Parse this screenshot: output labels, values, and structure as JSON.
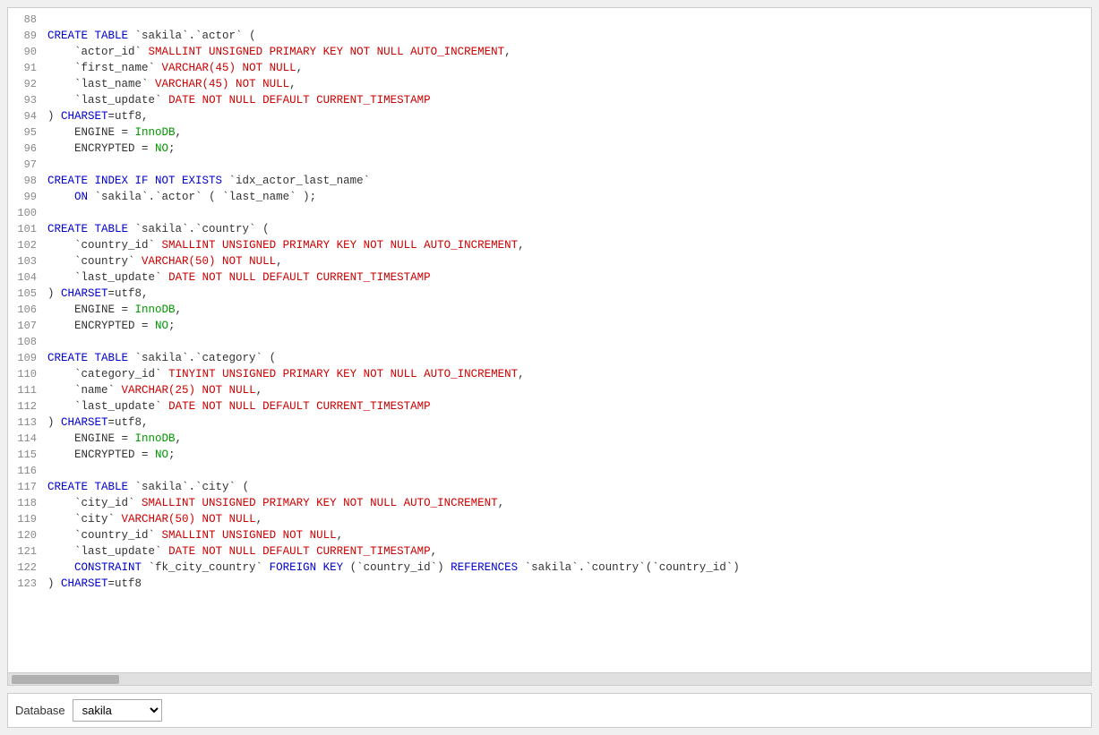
{
  "editor": {
    "lines": [
      {
        "num": "88",
        "tokens": []
      },
      {
        "num": "89",
        "tokens": [
          {
            "t": "kw",
            "v": "CREATE TABLE "
          },
          {
            "t": "str",
            "v": "`sakila`.`actor`"
          },
          {
            "t": "op",
            "v": " ("
          }
        ]
      },
      {
        "num": "90",
        "tokens": [
          {
            "t": "op",
            "v": "    "
          },
          {
            "t": "str",
            "v": "`actor_id`"
          },
          {
            "t": "op",
            "v": " "
          },
          {
            "t": "kw2",
            "v": "SMALLINT UNSIGNED PRIMARY KEY NOT NULL AUTO_INCREMENT"
          },
          {
            "t": "op",
            "v": ","
          }
        ]
      },
      {
        "num": "91",
        "tokens": [
          {
            "t": "op",
            "v": "    "
          },
          {
            "t": "str",
            "v": "`first_name`"
          },
          {
            "t": "op",
            "v": " "
          },
          {
            "t": "kw2",
            "v": "VARCHAR(45) NOT NULL"
          },
          {
            "t": "op",
            "v": ","
          }
        ]
      },
      {
        "num": "92",
        "tokens": [
          {
            "t": "op",
            "v": "    "
          },
          {
            "t": "str",
            "v": "`last_name`"
          },
          {
            "t": "op",
            "v": " "
          },
          {
            "t": "kw2",
            "v": "VARCHAR(45) NOT NULL"
          },
          {
            "t": "op",
            "v": ","
          }
        ]
      },
      {
        "num": "93",
        "tokens": [
          {
            "t": "op",
            "v": "    "
          },
          {
            "t": "str",
            "v": "`last_update`"
          },
          {
            "t": "op",
            "v": " "
          },
          {
            "t": "kw2",
            "v": "DATE NOT NULL DEFAULT CURRENT_TIMESTAMP"
          }
        ]
      },
      {
        "num": "94",
        "tokens": [
          {
            "t": "op",
            "v": ") "
          },
          {
            "t": "kw",
            "v": "CHARSET"
          },
          {
            "t": "op",
            "v": "=utf8,"
          }
        ]
      },
      {
        "num": "95",
        "tokens": [
          {
            "t": "op",
            "v": "    ENGINE = "
          },
          {
            "t": "val",
            "v": "InnoDB"
          },
          {
            "t": "op",
            "v": ","
          }
        ]
      },
      {
        "num": "96",
        "tokens": [
          {
            "t": "op",
            "v": "    ENCRYPTED = "
          },
          {
            "t": "val",
            "v": "NO"
          },
          {
            "t": "op",
            "v": ";"
          }
        ]
      },
      {
        "num": "97",
        "tokens": []
      },
      {
        "num": "98",
        "tokens": [
          {
            "t": "kw",
            "v": "CREATE INDEX IF NOT EXISTS "
          },
          {
            "t": "str",
            "v": "`idx_actor_last_name`"
          }
        ]
      },
      {
        "num": "99",
        "tokens": [
          {
            "t": "op",
            "v": "    "
          },
          {
            "t": "kw",
            "v": "ON "
          },
          {
            "t": "str",
            "v": "`sakila`.`actor`"
          },
          {
            "t": "op",
            "v": " ( "
          },
          {
            "t": "str",
            "v": "`last_name`"
          },
          {
            "t": "op",
            "v": " );"
          }
        ]
      },
      {
        "num": "100",
        "tokens": []
      },
      {
        "num": "101",
        "tokens": [
          {
            "t": "kw",
            "v": "CREATE TABLE "
          },
          {
            "t": "str",
            "v": "`sakila`.`country`"
          },
          {
            "t": "op",
            "v": " ("
          }
        ]
      },
      {
        "num": "102",
        "tokens": [
          {
            "t": "op",
            "v": "    "
          },
          {
            "t": "str",
            "v": "`country_id`"
          },
          {
            "t": "op",
            "v": " "
          },
          {
            "t": "kw2",
            "v": "SMALLINT UNSIGNED PRIMARY KEY NOT NULL AUTO_INCREMENT"
          },
          {
            "t": "op",
            "v": ","
          }
        ]
      },
      {
        "num": "103",
        "tokens": [
          {
            "t": "op",
            "v": "    "
          },
          {
            "t": "str",
            "v": "`country`"
          },
          {
            "t": "op",
            "v": " "
          },
          {
            "t": "kw2",
            "v": "VARCHAR(50) NOT NULL"
          },
          {
            "t": "op",
            "v": ","
          }
        ]
      },
      {
        "num": "104",
        "tokens": [
          {
            "t": "op",
            "v": "    "
          },
          {
            "t": "str",
            "v": "`last_update`"
          },
          {
            "t": "op",
            "v": " "
          },
          {
            "t": "kw2",
            "v": "DATE NOT NULL DEFAULT CURRENT_TIMESTAMP"
          }
        ]
      },
      {
        "num": "105",
        "tokens": [
          {
            "t": "op",
            "v": ") "
          },
          {
            "t": "kw",
            "v": "CHARSET"
          },
          {
            "t": "op",
            "v": "=utf8,"
          }
        ]
      },
      {
        "num": "106",
        "tokens": [
          {
            "t": "op",
            "v": "    ENGINE = "
          },
          {
            "t": "val",
            "v": "InnoDB"
          },
          {
            "t": "op",
            "v": ","
          }
        ]
      },
      {
        "num": "107",
        "tokens": [
          {
            "t": "op",
            "v": "    ENCRYPTED = "
          },
          {
            "t": "val",
            "v": "NO"
          },
          {
            "t": "op",
            "v": ";"
          }
        ]
      },
      {
        "num": "108",
        "tokens": []
      },
      {
        "num": "109",
        "tokens": [
          {
            "t": "kw",
            "v": "CREATE TABLE "
          },
          {
            "t": "str",
            "v": "`sakila`.`category`"
          },
          {
            "t": "op",
            "v": " ("
          }
        ]
      },
      {
        "num": "110",
        "tokens": [
          {
            "t": "op",
            "v": "    "
          },
          {
            "t": "str",
            "v": "`category_id`"
          },
          {
            "t": "op",
            "v": " "
          },
          {
            "t": "kw2",
            "v": "TINYINT UNSIGNED PRIMARY KEY NOT NULL AUTO_INCREMENT"
          },
          {
            "t": "op",
            "v": ","
          }
        ]
      },
      {
        "num": "111",
        "tokens": [
          {
            "t": "op",
            "v": "    "
          },
          {
            "t": "str",
            "v": "`name`"
          },
          {
            "t": "op",
            "v": " "
          },
          {
            "t": "kw2",
            "v": "VARCHAR(25) NOT NULL"
          },
          {
            "t": "op",
            "v": ","
          }
        ]
      },
      {
        "num": "112",
        "tokens": [
          {
            "t": "op",
            "v": "    "
          },
          {
            "t": "str",
            "v": "`last_update`"
          },
          {
            "t": "op",
            "v": " "
          },
          {
            "t": "kw2",
            "v": "DATE NOT NULL DEFAULT CURRENT_TIMESTAMP"
          }
        ]
      },
      {
        "num": "113",
        "tokens": [
          {
            "t": "op",
            "v": ") "
          },
          {
            "t": "kw",
            "v": "CHARSET"
          },
          {
            "t": "op",
            "v": "=utf8,"
          }
        ]
      },
      {
        "num": "114",
        "tokens": [
          {
            "t": "op",
            "v": "    ENGINE = "
          },
          {
            "t": "val",
            "v": "InnoDB"
          },
          {
            "t": "op",
            "v": ","
          }
        ]
      },
      {
        "num": "115",
        "tokens": [
          {
            "t": "op",
            "v": "    ENCRYPTED = "
          },
          {
            "t": "val",
            "v": "NO"
          },
          {
            "t": "op",
            "v": ";"
          }
        ]
      },
      {
        "num": "116",
        "tokens": []
      },
      {
        "num": "117",
        "tokens": [
          {
            "t": "kw",
            "v": "CREATE TABLE "
          },
          {
            "t": "str",
            "v": "`sakila`.`city`"
          },
          {
            "t": "op",
            "v": " ("
          }
        ]
      },
      {
        "num": "118",
        "tokens": [
          {
            "t": "op",
            "v": "    "
          },
          {
            "t": "str",
            "v": "`city_id`"
          },
          {
            "t": "op",
            "v": " "
          },
          {
            "t": "kw2",
            "v": "SMALLINT UNSIGNED PRIMARY KEY NOT NULL AUTO_INCREMENT"
          },
          {
            "t": "op",
            "v": ","
          }
        ]
      },
      {
        "num": "119",
        "tokens": [
          {
            "t": "op",
            "v": "    "
          },
          {
            "t": "str",
            "v": "`city`"
          },
          {
            "t": "op",
            "v": " "
          },
          {
            "t": "kw2",
            "v": "VARCHAR(50) NOT NULL"
          },
          {
            "t": "op",
            "v": ","
          }
        ]
      },
      {
        "num": "120",
        "tokens": [
          {
            "t": "op",
            "v": "    "
          },
          {
            "t": "str",
            "v": "`country_id`"
          },
          {
            "t": "op",
            "v": " "
          },
          {
            "t": "kw2",
            "v": "SMALLINT UNSIGNED NOT NULL"
          },
          {
            "t": "op",
            "v": ","
          }
        ]
      },
      {
        "num": "121",
        "tokens": [
          {
            "t": "op",
            "v": "    "
          },
          {
            "t": "str",
            "v": "`last_update`"
          },
          {
            "t": "op",
            "v": " "
          },
          {
            "t": "kw2",
            "v": "DATE NOT NULL DEFAULT CURRENT_TIMESTAMP"
          },
          {
            "t": "op",
            "v": ","
          }
        ]
      },
      {
        "num": "122",
        "tokens": [
          {
            "t": "op",
            "v": "    "
          },
          {
            "t": "kw",
            "v": "CONSTRAINT "
          },
          {
            "t": "str",
            "v": "`fk_city_country`"
          },
          {
            "t": "op",
            "v": " "
          },
          {
            "t": "kw",
            "v": "FOREIGN KEY "
          },
          {
            "t": "op",
            "v": "("
          },
          {
            "t": "str",
            "v": "`country_id`"
          },
          {
            "t": "op",
            "v": ") "
          },
          {
            "t": "kw",
            "v": "REFERENCES "
          },
          {
            "t": "str",
            "v": "`sakila`.`country`"
          },
          {
            "t": "op",
            "v": "("
          },
          {
            "t": "str",
            "v": "`country_id`"
          },
          {
            "t": "op",
            "v": ")"
          }
        ]
      },
      {
        "num": "123",
        "tokens": [
          {
            "t": "op",
            "v": ") "
          },
          {
            "t": "kw",
            "v": "CHARSET"
          },
          {
            "t": "op",
            "v": "=utf8"
          }
        ]
      }
    ]
  },
  "bottom_bar": {
    "database_label": "Database",
    "database_value": "sakila"
  }
}
